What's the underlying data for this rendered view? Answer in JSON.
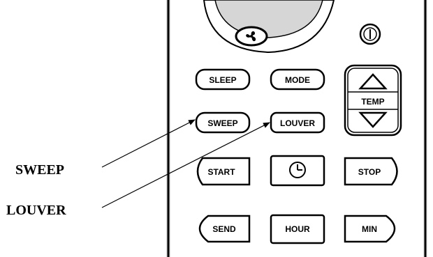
{
  "callouts": {
    "sweep": "SWEEP",
    "louver": "LOUVER"
  },
  "buttons": {
    "sleep": "SLEEP",
    "mode": "MODE",
    "temp": "TEMP",
    "sweep": "SWEEP",
    "louver": "LOUVER",
    "start": "START",
    "stop": "STOP",
    "send": "SEND",
    "hour": "HOUR",
    "min": "MIN"
  },
  "icons": {
    "fan": "fan-icon",
    "power": "power-icon",
    "clock": "clock-icon",
    "temp_up": "triangle-up-icon",
    "temp_down": "triangle-down-icon"
  },
  "colors": {
    "ink": "#000000",
    "remote_body": "#ffffff",
    "remote_edge": "#e2e2e2",
    "dome": "#d6d6d6"
  }
}
